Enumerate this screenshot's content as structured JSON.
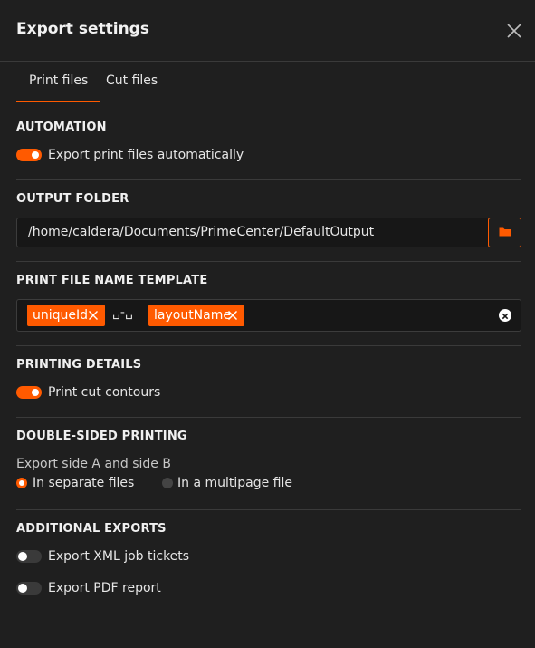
{
  "dialog": {
    "title": "Export settings"
  },
  "tabs": [
    {
      "label": "Print files",
      "active": true
    },
    {
      "label": "Cut files",
      "active": false
    }
  ],
  "automation": {
    "title": "AUTOMATION",
    "export_automatically": {
      "label": "Export print files automatically",
      "checked": true
    }
  },
  "output_folder": {
    "title": "OUTPUT FOLDER",
    "value": "/home/caldera/Documents/PrimeCenter/DefaultOutput",
    "browse_icon": "folder-icon"
  },
  "file_name_template": {
    "title": "PRINT FILE NAME TEMPLATE",
    "tokens": [
      "uniqueId",
      "layoutName"
    ],
    "separator": "␣-␣"
  },
  "printing_details": {
    "title": "PRINTING DETAILS",
    "print_cut_contours": {
      "label": "Print cut contours",
      "checked": true
    }
  },
  "double_sided": {
    "title": "DOUBLE-SIDED PRINTING",
    "subtitle": "Export side A and side B",
    "options": [
      {
        "label": "In separate files",
        "selected": true
      },
      {
        "label": "In a multipage file",
        "selected": false
      }
    ]
  },
  "additional_exports": {
    "title": "ADDITIONAL EXPORTS",
    "xml_tickets": {
      "label": "Export XML job tickets",
      "checked": false
    },
    "pdf_report": {
      "label": "Export PDF report",
      "checked": false
    }
  },
  "colors": {
    "accent": "#ff5a00",
    "background": "#1f1f1f",
    "input_bg": "#171717",
    "divider": "#3a3a3a"
  }
}
